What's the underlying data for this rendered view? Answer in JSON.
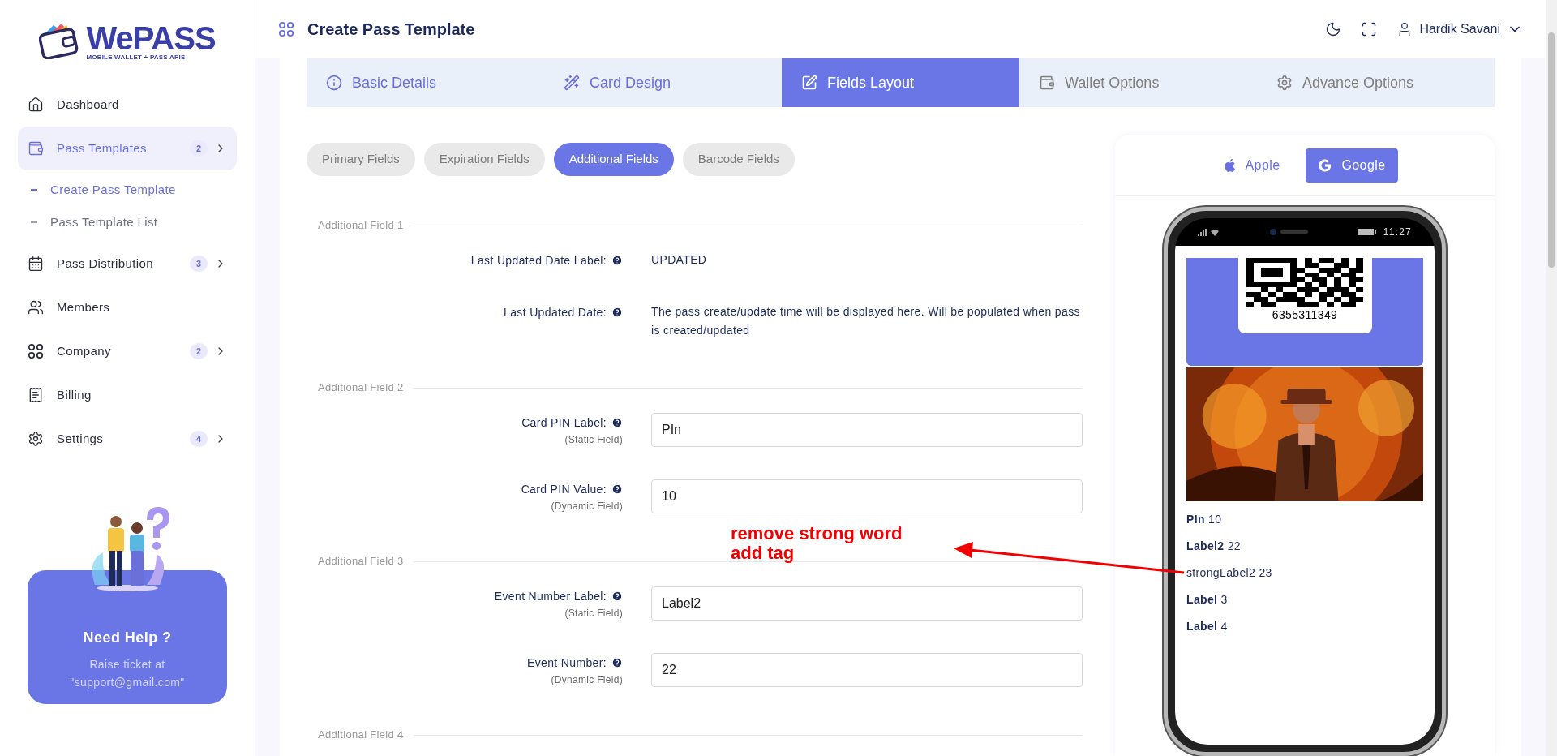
{
  "logo": {
    "name": "WePASS",
    "tagline": "MOBILE WALLET + PASS APIS"
  },
  "sidebar": {
    "items": [
      {
        "label": "Dashboard",
        "selected": false
      },
      {
        "label": "Pass Templates",
        "selected": true,
        "badge": "2",
        "children": [
          {
            "label": "Create Pass Template",
            "selected": true
          },
          {
            "label": "Pass Template List",
            "selected": false
          }
        ]
      },
      {
        "label": "Pass Distribution",
        "selected": false,
        "badge": "3"
      },
      {
        "label": "Members",
        "selected": false
      },
      {
        "label": "Company",
        "selected": false,
        "badge": "2"
      },
      {
        "label": "Billing",
        "selected": false
      },
      {
        "label": "Settings",
        "selected": false,
        "badge": "4"
      }
    ]
  },
  "help_card": {
    "title": "Need Help ?",
    "text": "Raise ticket at \"support@gmail.com\""
  },
  "header": {
    "title": "Create Pass Template",
    "user": "Hardik Savani"
  },
  "steps": [
    {
      "label": "Basic Details",
      "selected": false,
      "completed": true
    },
    {
      "label": "Card Design",
      "selected": false,
      "completed": true
    },
    {
      "label": "Fields Layout",
      "selected": true,
      "completed": true
    },
    {
      "label": "Wallet Options",
      "selected": false,
      "completed": false
    },
    {
      "label": "Advance Options",
      "selected": false,
      "completed": false
    }
  ],
  "field_tabs": [
    {
      "label": "Primary Fields",
      "selected": false
    },
    {
      "label": "Expiration Fields",
      "selected": false
    },
    {
      "label": "Additional Fields",
      "selected": true
    },
    {
      "label": "Barcode Fields",
      "selected": false
    }
  ],
  "sections": [
    {
      "title": "Additional Field 1",
      "rows": [
        {
          "kind": "text",
          "label": "Last Updated Date Label:",
          "value": "UPDATED"
        },
        {
          "kind": "text",
          "label": "Last Updated Date:",
          "value": "The pass create/update time will be displayed here. Will be populated when pass is created/updated"
        }
      ]
    },
    {
      "title": "Additional Field 2",
      "rows": [
        {
          "kind": "input",
          "label": "Card PIN Label:",
          "note": "(Static Field)",
          "value": "PIn"
        },
        {
          "kind": "input",
          "label": "Card PIN Value:",
          "note": "(Dynamic Field)",
          "value": "10"
        }
      ]
    },
    {
      "title": "Additional Field 3",
      "rows": [
        {
          "kind": "input",
          "label": "Event Number Label:",
          "note": "(Static Field)",
          "value": "Label2"
        },
        {
          "kind": "input",
          "label": "Event Number:",
          "note": "(Dynamic Field)",
          "value": "22"
        }
      ]
    },
    {
      "title": "Additional Field 4"
    }
  ],
  "preview": {
    "platforms": [
      {
        "label": "Apple",
        "selected": false
      },
      {
        "label": "Google",
        "selected": true
      }
    ],
    "time": "11:27",
    "barcode_number": "6355311349",
    "fields": [
      {
        "label": "PIn",
        "value": "10",
        "bold": true
      },
      {
        "label": "Label2",
        "value": "22",
        "bold": true
      },
      {
        "label": "strongLabel2",
        "value": "23",
        "bold": false
      },
      {
        "label": "Label",
        "value": "3",
        "bold": true
      },
      {
        "label": "Label",
        "value": "4",
        "bold": true
      }
    ]
  },
  "annotation": {
    "lines": [
      "remove strong word",
      "add tag"
    ]
  }
}
